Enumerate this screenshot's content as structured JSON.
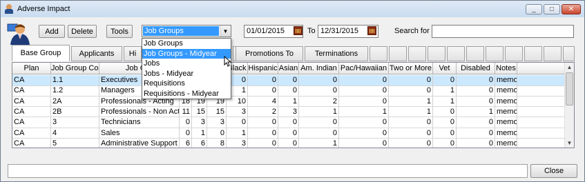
{
  "window": {
    "title": "Adverse Impact",
    "min": "_",
    "max": "□",
    "close": "✕"
  },
  "toolbar": {
    "add": "Add",
    "delete": "Delete",
    "tools": "Tools"
  },
  "group_select": {
    "value": "Job Groups",
    "arrow": "▼"
  },
  "dates": {
    "from": "01/01/2015",
    "to_label": "To",
    "to": "12/31/2015"
  },
  "search": {
    "label": "Search for :",
    "value": ""
  },
  "tabs": [
    "Base Group",
    "Applicants",
    "Hi",
    "",
    "Promotions To",
    "Terminations"
  ],
  "dropdown": [
    "Job Groups",
    "Job Groups - Midyear",
    "Jobs",
    "Jobs - Midyear",
    "Requisitions",
    "Requisitions - Midyear"
  ],
  "columns": [
    "Plan",
    "Job Group Code",
    "Job Gro",
    "",
    "",
    "White",
    "Black",
    "Hispanic",
    "Asian",
    "Am. Indian",
    "Pac/Hawaiian",
    "Two or More",
    "Vet",
    "Disabled",
    "Notes"
  ],
  "rows": [
    [
      "CA",
      "1.1",
      "Executives",
      "",
      "",
      "2",
      "0",
      "0",
      "0",
      "0",
      "0",
      "0",
      "0",
      "0",
      "memo"
    ],
    [
      "CA",
      "1.2",
      "Managers",
      "",
      "",
      "5",
      "1",
      "0",
      "0",
      "0",
      "0",
      "0",
      "1",
      "0",
      "memo"
    ],
    [
      "CA",
      "2A",
      "Professionals - Acting",
      "18",
      "19",
      "19",
      "10",
      "4",
      "1",
      "2",
      "0",
      "1",
      "1",
      "0",
      "memo"
    ],
    [
      "CA",
      "2B",
      "Professionals - Non Actin",
      "11",
      "15",
      "15",
      "3",
      "2",
      "3",
      "1",
      "1",
      "1",
      "0",
      "1",
      "memo"
    ],
    [
      "CA",
      "3",
      "Technicians",
      "0",
      "3",
      "3",
      "0",
      "0",
      "0",
      "0",
      "0",
      "0",
      "0",
      "0",
      "memo"
    ],
    [
      "CA",
      "4",
      "Sales",
      "0",
      "1",
      "0",
      "1",
      "0",
      "0",
      "0",
      "0",
      "0",
      "0",
      "0",
      "memo"
    ],
    [
      "CA",
      "5",
      "Administrative Support",
      "6",
      "6",
      "8",
      "3",
      "0",
      "0",
      "1",
      "0",
      "0",
      "0",
      "0",
      "memo"
    ]
  ],
  "footer": {
    "close": "Close"
  }
}
